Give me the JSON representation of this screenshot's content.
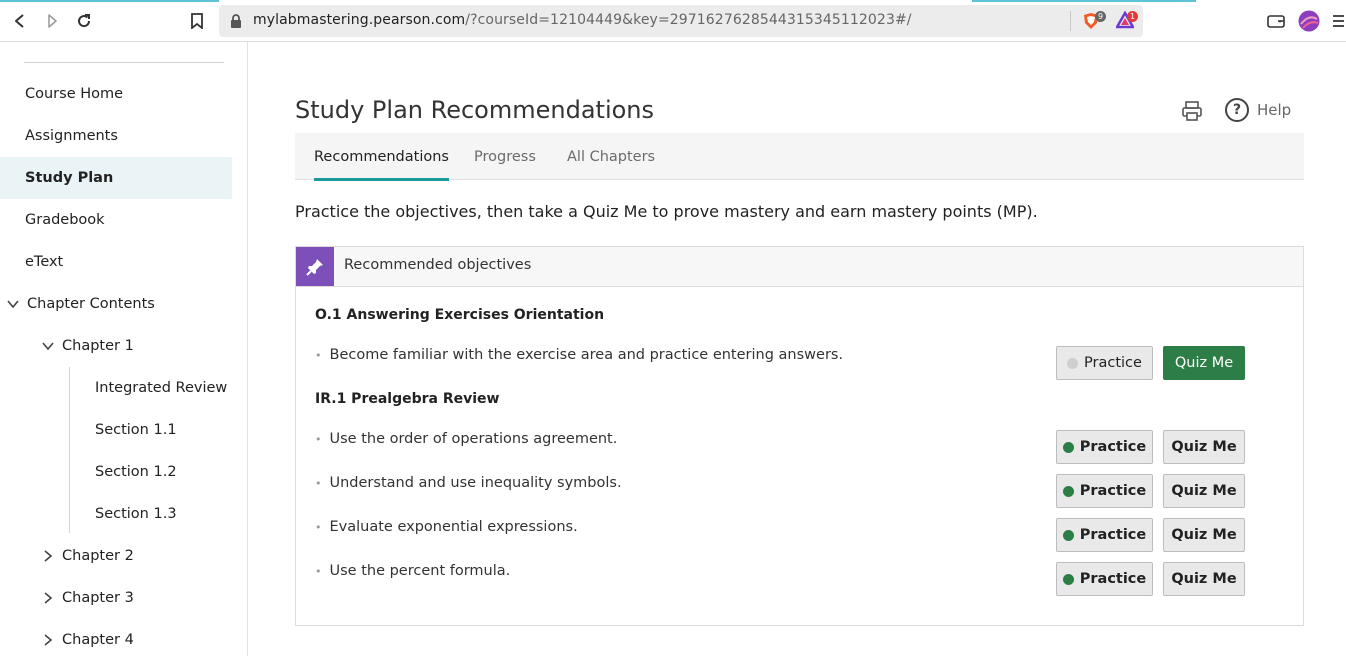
{
  "browser": {
    "url_host": "mylabmastering.pearson.com",
    "url_rest": "/?courseId=12104449&key=29716276285443153451120​23#/",
    "shield_count": "9",
    "rewards_count": "1",
    "accent_color": "#5ec3d6"
  },
  "sidebar": {
    "items": [
      {
        "label": "Course Home"
      },
      {
        "label": "Assignments"
      },
      {
        "label": "Study Plan"
      },
      {
        "label": "Gradebook"
      },
      {
        "label": "eText"
      },
      {
        "label": "Chapter Contents"
      },
      {
        "label": "Chapter 1"
      },
      {
        "label": "Integrated Review"
      },
      {
        "label": "Section 1.1"
      },
      {
        "label": "Section 1.2"
      },
      {
        "label": "Section 1.3"
      },
      {
        "label": "Chapter 2"
      },
      {
        "label": "Chapter 3"
      },
      {
        "label": "Chapter 4"
      }
    ],
    "active_label": "Study Plan"
  },
  "main": {
    "title": "Study Plan Recommendations",
    "help_label": "Help",
    "tabs": [
      {
        "label": "Recommendations"
      },
      {
        "label": "Progress"
      },
      {
        "label": "All Chapters"
      }
    ],
    "intro": "Practice the objectives, then take a Quiz Me to prove mastery and earn mastery points (MP).",
    "panel_title": "Recommended objectives",
    "objectives": [
      {
        "heading": "O.1 Answering Exercises Orientation",
        "items": [
          {
            "text": "Become familiar with the exercise area and practice entering answers.",
            "practice_label": "Practice",
            "quiz_label": "Quiz Me",
            "practice_status": "not-started"
          }
        ]
      },
      {
        "heading": "IR.1 Prealgebra Review",
        "items": [
          {
            "text": "Use the order of operations agreement.",
            "practice_label": "Practice",
            "quiz_label": "Quiz Me",
            "practice_status": "completed"
          },
          {
            "text": "Understand and use inequality symbols.",
            "practice_label": "Practice",
            "quiz_label": "Quiz Me",
            "practice_status": "completed"
          },
          {
            "text": "Evaluate exponential expressions.",
            "practice_label": "Practice",
            "quiz_label": "Quiz Me",
            "practice_status": "completed"
          },
          {
            "text": "Use the percent formula.",
            "practice_label": "Practice",
            "quiz_label": "Quiz Me",
            "practice_status": "completed"
          }
        ]
      }
    ],
    "colors": {
      "tab_accent": "#1a9a9a",
      "pin_bg": "#7d4fb8",
      "quiz_primary": "#2d7d46",
      "status_completed": "#2d7d46",
      "status_not_started": "#cfcfcf"
    }
  }
}
